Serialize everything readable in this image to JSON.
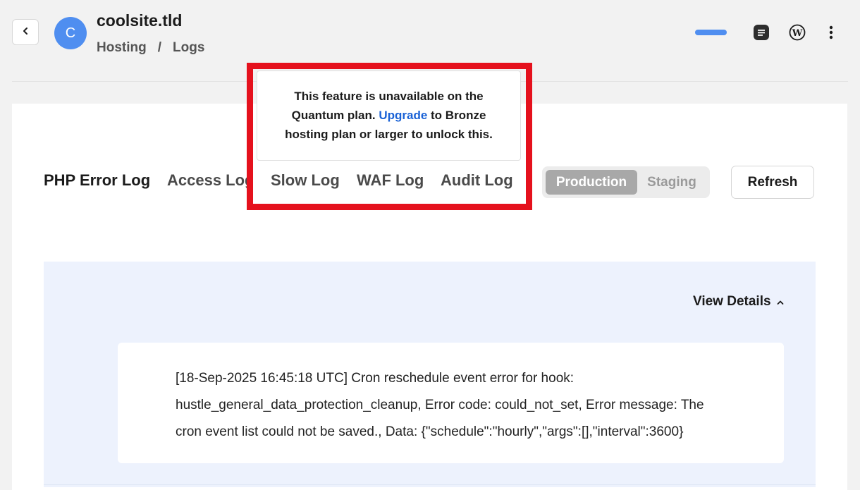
{
  "header": {
    "avatar_letter": "C",
    "site_title": "coolsite.tld",
    "breadcrumb": [
      "Hosting",
      "/",
      "Logs"
    ],
    "progress_color": "#4f8ef0",
    "icons": [
      "back-chevron-icon",
      "notes-icon",
      "wordpress-icon",
      "more-vertical-icon"
    ]
  },
  "tabs": [
    {
      "label": "PHP Error Log",
      "active": true
    },
    {
      "label": "Access Log",
      "active": false
    },
    {
      "label": "Slow Log",
      "active": false
    },
    {
      "label": "WAF Log",
      "active": false
    },
    {
      "label": "Audit Log",
      "active": false
    }
  ],
  "environment": {
    "options": [
      "Production",
      "Staging"
    ],
    "selected": "Production"
  },
  "refresh_label": "Refresh",
  "tooltip": {
    "text_before": "This feature is unavailable on the Quantum plan. ",
    "link": "Upgrade",
    "text_after": " to Bronze hosting plan or larger to unlock this."
  },
  "highlight_color": "#e5111d",
  "log": {
    "view_details_label": "View Details",
    "entry": "[18-Sep-2025 16:45:18 UTC] Cron reschedule event error for hook: hustle_general_data_protection_cleanup, Error code: could_not_set, Error message: The cron event list could not be saved., Data: {\"schedule\":\"hourly\",\"args\":[],\"interval\":3600}"
  }
}
